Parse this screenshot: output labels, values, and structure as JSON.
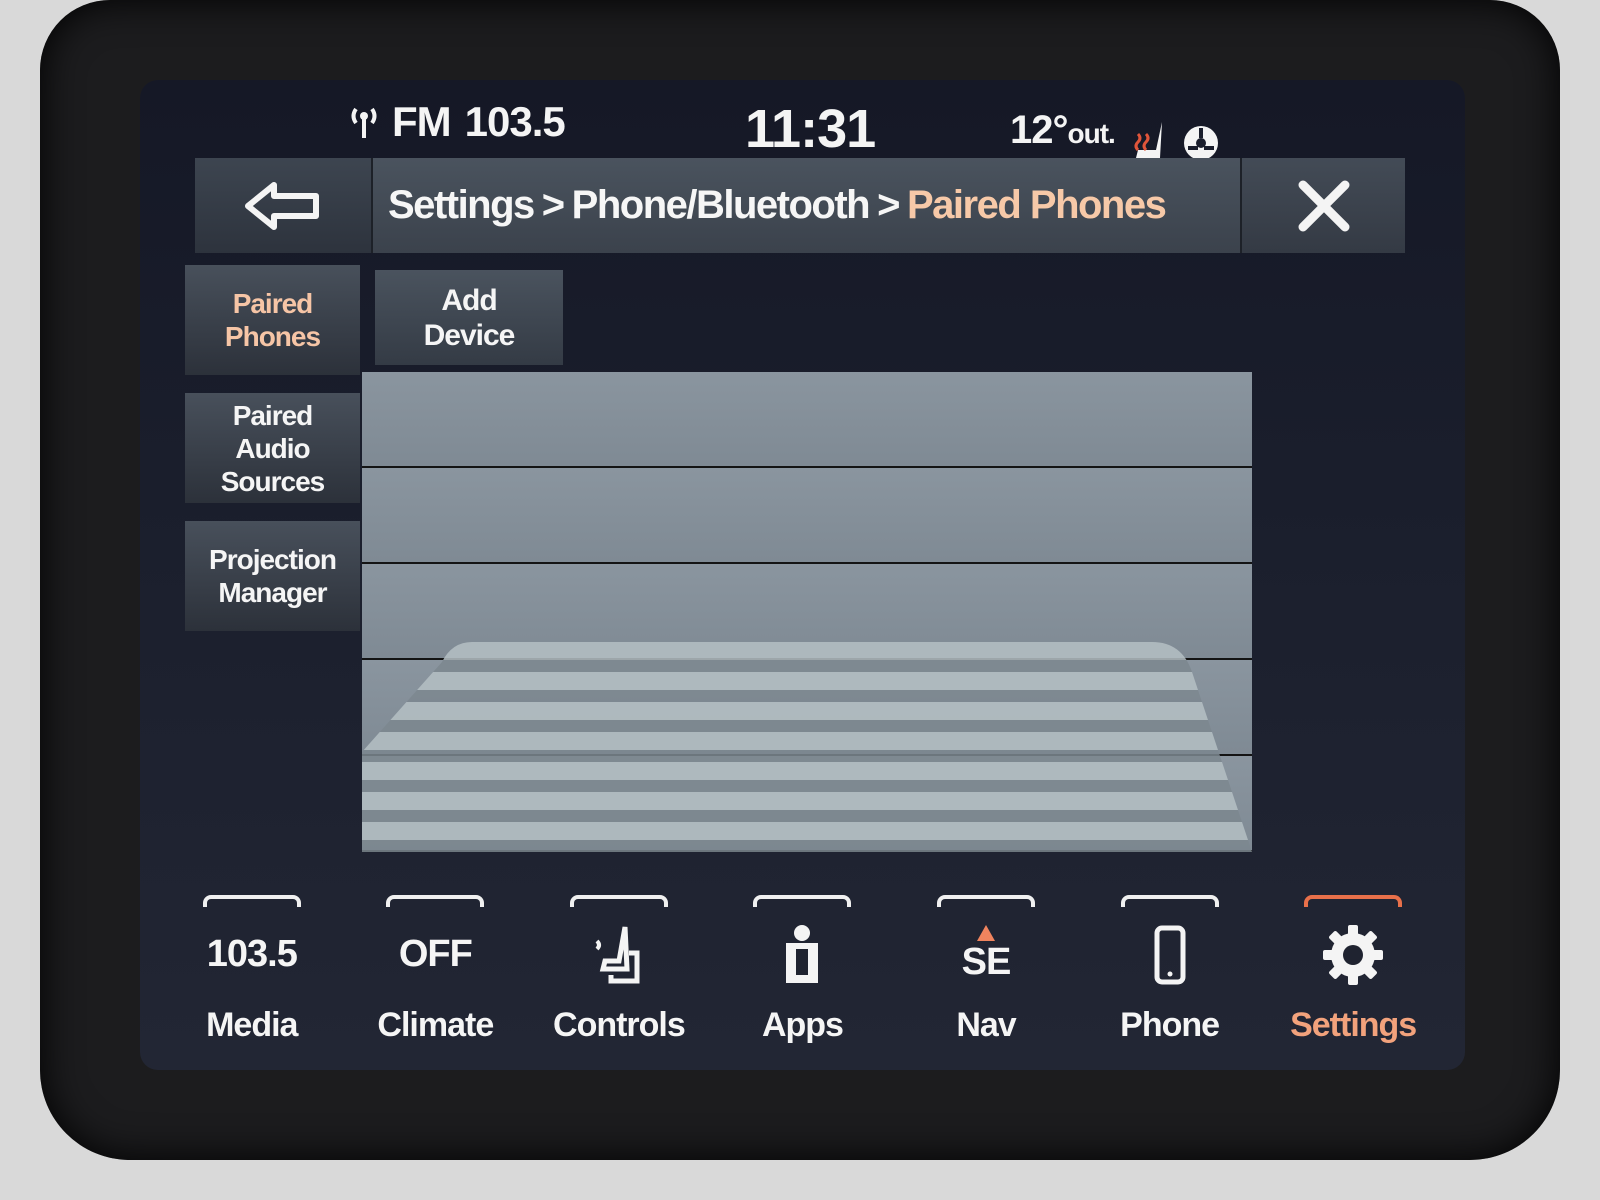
{
  "status_bar": {
    "radio_band": "FM",
    "radio_freq": "103.5",
    "clock": "11:31",
    "temperature": "12°",
    "temperature_suffix": "out."
  },
  "header": {
    "breadcrumb": [
      "Settings",
      "Phone/Bluetooth",
      "Paired Phones"
    ],
    "separator": ">"
  },
  "side_tabs": [
    {
      "label": "Paired\nPhones",
      "active": true
    },
    {
      "label": "Paired\nAudio\nSources",
      "active": false
    },
    {
      "label": "Projection\nManager",
      "active": false
    }
  ],
  "add_device_label": "Add\nDevice",
  "device_rows": [
    "",
    "",
    "",
    "",
    ""
  ],
  "bottom_nav": [
    {
      "label": "Media",
      "glyph_text": "103.5",
      "icon": "text",
      "active": false
    },
    {
      "label": "Climate",
      "glyph_text": "OFF",
      "icon": "text",
      "active": false
    },
    {
      "label": "Controls",
      "glyph_text": "",
      "icon": "controls-icon",
      "active": false
    },
    {
      "label": "Apps",
      "glyph_text": "",
      "icon": "apps-icon",
      "active": false
    },
    {
      "label": "Nav",
      "glyph_text": "SE",
      "icon": "compass-text",
      "active": false
    },
    {
      "label": "Phone",
      "glyph_text": "",
      "icon": "phone-icon",
      "active": false
    },
    {
      "label": "Settings",
      "glyph_text": "",
      "icon": "gear-icon",
      "active": true
    }
  ],
  "colors": {
    "accent": "#f2a27c",
    "active_indicator": "#e8704a",
    "text": "#f5f5f5"
  }
}
